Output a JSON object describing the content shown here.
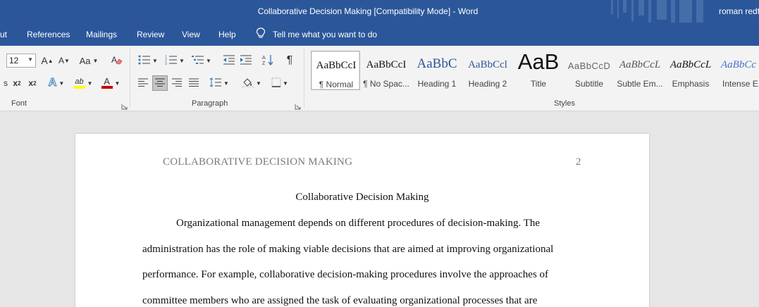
{
  "titlebar": {
    "title": "Collaborative Decision Making [Compatibility Mode]  -  Word",
    "user": "roman redt"
  },
  "menu": {
    "items": [
      "ut",
      "References",
      "Mailings",
      "Review",
      "View",
      "Help"
    ],
    "tell_me": "Tell me what you want to do"
  },
  "ribbon": {
    "font": {
      "size": "12",
      "label": "Font",
      "grow": "A",
      "shrink": "A",
      "change_case": "Aa",
      "subscript": "x",
      "superscript": "x",
      "text_effects": "A",
      "highlight": "ab",
      "font_color": "A",
      "highlight_color": "#ffff00",
      "font_color_value": "#c00000"
    },
    "paragraph": {
      "label": "Paragraph"
    },
    "styles": {
      "label": "Styles",
      "items": [
        {
          "preview": "AaBbCcI",
          "name": "¶ Normal"
        },
        {
          "preview": "AaBbCcI",
          "name": "¶ No Spac..."
        },
        {
          "preview": "AaBbC",
          "name": "Heading 1"
        },
        {
          "preview": "AaBbCcl",
          "name": "Heading 2"
        },
        {
          "preview": "AaB",
          "name": "Title"
        },
        {
          "preview": "AaBbCcD",
          "name": "Subtitle"
        },
        {
          "preview": "AaBbCcL",
          "name": "Subtle Em..."
        },
        {
          "preview": "AaBbCcL",
          "name": "Emphasis"
        },
        {
          "preview": "AaBbCc",
          "name": "Intense E..."
        }
      ]
    }
  },
  "document": {
    "header": "COLLABORATIVE DECISION MAKING",
    "page_number": "2",
    "title": "Collaborative Decision Making",
    "lines": [
      "Organizational management depends on different procedures of decision-making. The",
      "administration has the role of making viable decisions that are aimed at improving organizational",
      "performance. For example, collaborative decision-making procedures involve the approaches of",
      "committee members who are assigned the task of evaluating organizational processes that are"
    ]
  },
  "colors": {
    "word_blue": "#2b579a",
    "ribbon_bg": "#f3f3f3",
    "canvas_bg": "#e6e6e6"
  }
}
